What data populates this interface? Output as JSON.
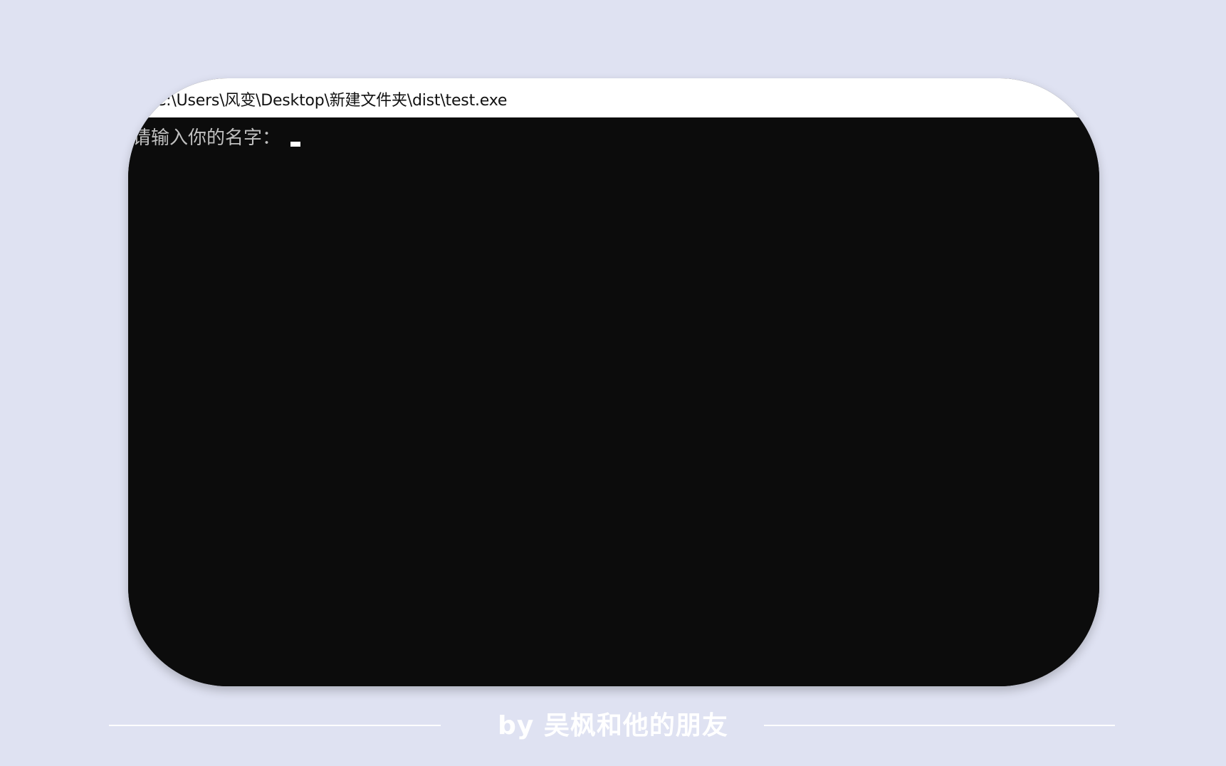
{
  "window": {
    "title": "C:\\Users\\风变\\Desktop\\新建文件夹\\dist\\test.exe",
    "icon": "console-app-icon"
  },
  "console": {
    "prompt": "请输入你的名字：",
    "background_color": "#0c0c0c",
    "text_color": "#c0c0c0"
  },
  "footer": {
    "credit": "by 吴枫和他的朋友"
  },
  "colors": {
    "page_background": "#dfe2f2",
    "accent": "#ffffff"
  }
}
